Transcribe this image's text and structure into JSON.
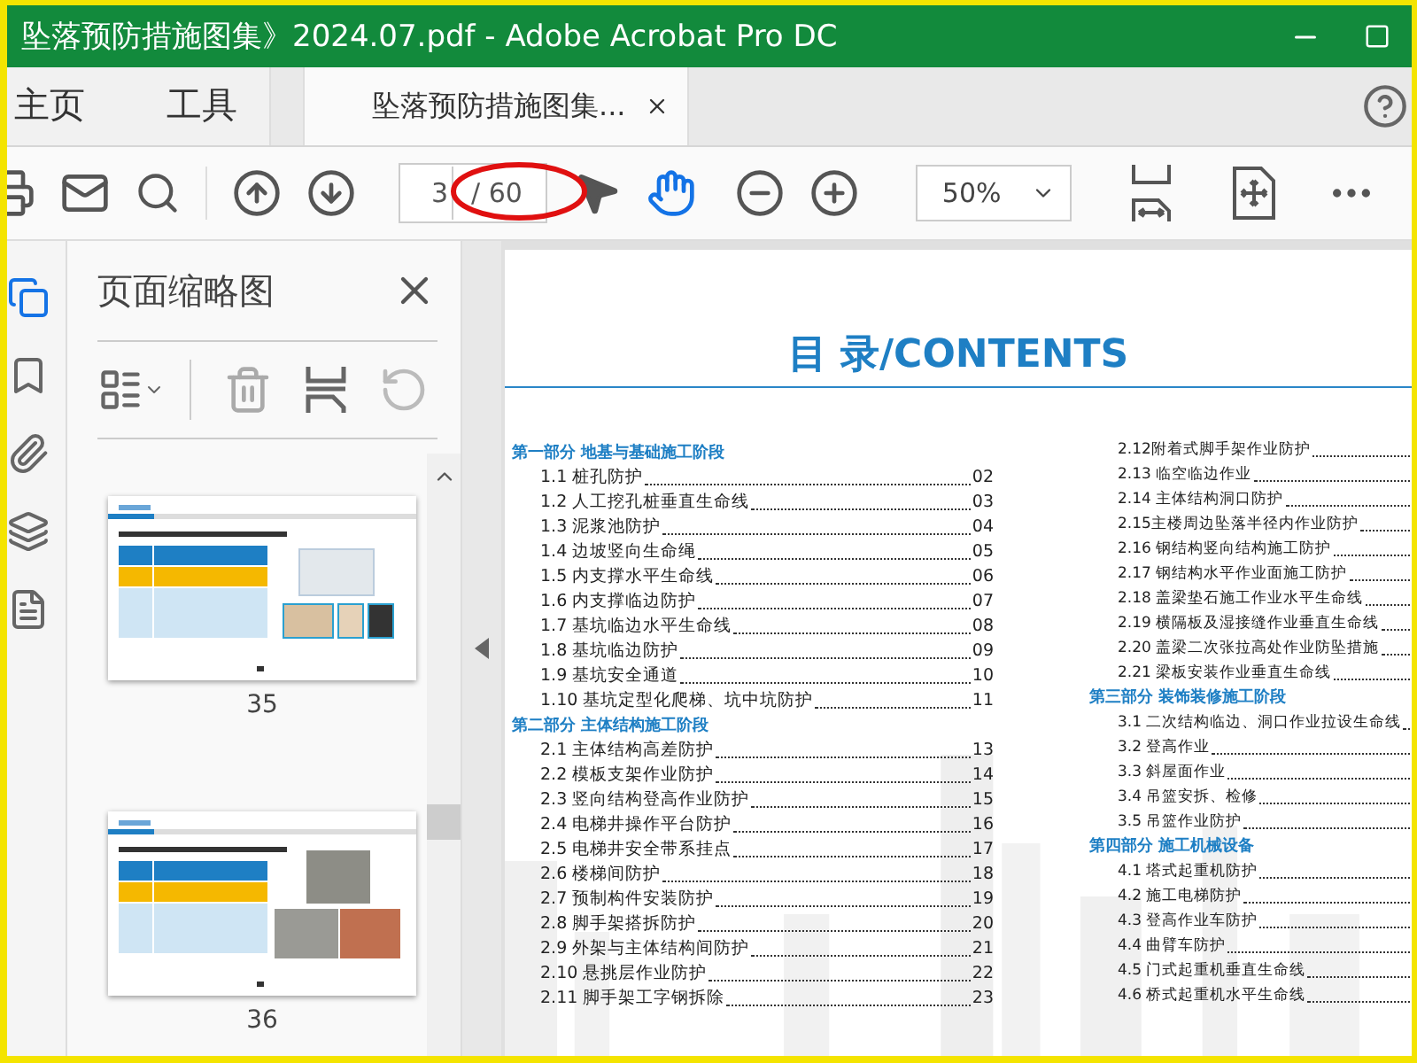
{
  "window": {
    "title": "坠落预防措施图集》2024.07.pdf - Adobe Acrobat Pro DC"
  },
  "tabs": [
    {
      "label": "主页",
      "kind": "nav",
      "selected": false
    },
    {
      "label": "工具",
      "kind": "nav",
      "selected": false
    },
    {
      "label": "坠落预防措施图集...",
      "kind": "document",
      "selected": true
    }
  ],
  "toolbar": {
    "page_number": "3",
    "page_total": "/ 60",
    "zoom": "50%",
    "tools": [
      {
        "kind": "select",
        "selected": false
      },
      {
        "kind": "hand",
        "selected": true
      }
    ]
  },
  "sidebar_icons": [
    {
      "kind": "pages",
      "selected": true
    },
    {
      "kind": "bookmark",
      "selected": false
    },
    {
      "kind": "attachment",
      "selected": false
    },
    {
      "kind": "layers",
      "selected": false
    },
    {
      "kind": "document",
      "selected": false
    }
  ],
  "thumbnails_panel": {
    "title": "页面缩略图",
    "pages": [
      {
        "label": "35",
        "kind": "single"
      },
      {
        "label": "36",
        "kind": "triple"
      }
    ]
  },
  "document": {
    "heading": "目 录/CONTENTS",
    "columns": [
      [
        {
          "kind": "section",
          "text": "第一部分 地基与基础施工阶段"
        },
        {
          "kind": "entry",
          "text": "1.1 桩孔防护",
          "page": "02"
        },
        {
          "kind": "entry",
          "text": "1.2 人工挖孔桩垂直生命线",
          "page": "03"
        },
        {
          "kind": "entry",
          "text": "1.3 泥浆池防护",
          "page": "04"
        },
        {
          "kind": "entry",
          "text": "1.4 边坡竖向生命绳",
          "page": "05"
        },
        {
          "kind": "entry",
          "text": "1.5 内支撑水平生命线",
          "page": "06"
        },
        {
          "kind": "entry",
          "text": "1.6 内支撑临边防护",
          "page": "07"
        },
        {
          "kind": "entry",
          "text": "1.7 基坑临边水平生命线",
          "page": "08"
        },
        {
          "kind": "entry",
          "text": "1.8 基坑临边防护",
          "page": "09"
        },
        {
          "kind": "entry",
          "text": "1.9 基坑安全通道",
          "page": "10"
        },
        {
          "kind": "entry",
          "text": "1.10 基坑定型化爬梯、坑中坑防护",
          "page": "11"
        },
        {
          "kind": "section",
          "text": "第二部分 主体结构施工阶段"
        },
        {
          "kind": "entry",
          "text": "2.1 主体结构高差防护",
          "page": "13"
        },
        {
          "kind": "entry",
          "text": "2.2 模板支架作业防护",
          "page": "14"
        },
        {
          "kind": "entry",
          "text": "2.3 竖向结构登高作业防护",
          "page": "15"
        },
        {
          "kind": "entry",
          "text": "2.4 电梯井操作平台防护",
          "page": "16"
        },
        {
          "kind": "entry",
          "text": "2.5 电梯井安全带系挂点",
          "page": "17"
        },
        {
          "kind": "entry",
          "text": "2.6 楼梯间防护",
          "page": "18"
        },
        {
          "kind": "entry",
          "text": "2.7 预制构件安装防护",
          "page": "19"
        },
        {
          "kind": "entry",
          "text": "2.8 脚手架搭拆防护",
          "page": "20"
        },
        {
          "kind": "entry",
          "text": "2.9 外架与主体结构间防护",
          "page": "21"
        },
        {
          "kind": "entry",
          "text": "2.10 悬挑层作业防护",
          "page": "22"
        },
        {
          "kind": "entry",
          "text": "2.11 脚手架工字钢拆除",
          "page": "23"
        }
      ],
      [
        {
          "kind": "entry",
          "text": "2.12附着式脚手架作业防护"
        },
        {
          "kind": "entry",
          "text": "2.13 临空临边作业"
        },
        {
          "kind": "entry",
          "text": "2.14 主体结构洞口防护"
        },
        {
          "kind": "entry",
          "text": "2.15主楼周边坠落半径内作业防护"
        },
        {
          "kind": "entry",
          "text": "2.16 钢结构竖向结构施工防护"
        },
        {
          "kind": "entry",
          "text": "2.17 钢结构水平作业面施工防护"
        },
        {
          "kind": "entry",
          "text": "2.18 盖梁垫石施工作业水平生命线"
        },
        {
          "kind": "entry",
          "text": "2.19 横隔板及湿接缝作业垂直生命线"
        },
        {
          "kind": "entry",
          "text": "2.20 盖梁二次张拉高处作业防坠措施"
        },
        {
          "kind": "entry",
          "text": "2.21 梁板安装作业垂直生命线"
        },
        {
          "kind": "section",
          "text": "第三部分 装饰装修施工阶段"
        },
        {
          "kind": "entry",
          "text": "3.1 二次结构临边、洞口作业拉设生命线"
        },
        {
          "kind": "entry",
          "text": "3.2 登高作业"
        },
        {
          "kind": "entry",
          "text": "3.3 斜屋面作业"
        },
        {
          "kind": "entry",
          "text": "3.4 吊篮安拆、检修"
        },
        {
          "kind": "entry",
          "text": "3.5 吊篮作业防护"
        },
        {
          "kind": "section",
          "text": "第四部分 施工机械设备"
        },
        {
          "kind": "entry",
          "text": "4.1 塔式起重机防护"
        },
        {
          "kind": "entry",
          "text": "4.2 施工电梯防护"
        },
        {
          "kind": "entry",
          "text": "4.3 登高作业车防护"
        },
        {
          "kind": "entry",
          "text": "4.4 曲臂车防护"
        },
        {
          "kind": "entry",
          "text": "4.5 门式起重机垂直生命线"
        },
        {
          "kind": "entry",
          "text": "4.6 桥式起重机水平生命线"
        }
      ]
    ]
  }
}
